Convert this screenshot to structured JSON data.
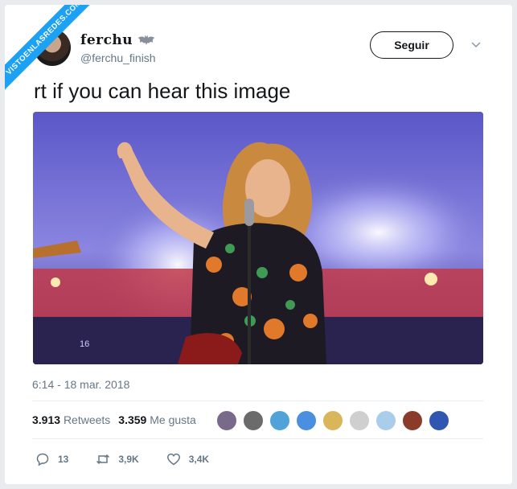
{
  "watermark": "VISTOENLASREDES.COM",
  "author": {
    "display_name": "ferchu",
    "handle": "@ferchu_finish"
  },
  "follow_button": "Seguir",
  "tweet_text": "rt if you can hear this image",
  "media": {
    "screen_number": "16"
  },
  "timestamp": "6:14 - 18 mar. 2018",
  "stats": {
    "retweets_count": "3.913",
    "retweets_label": "Retweets",
    "likes_count": "3.359",
    "likes_label": "Me gusta"
  },
  "actions": {
    "reply_count": "13",
    "retweet_count": "3,9K",
    "like_count": "3,4K"
  },
  "colors": {
    "accent": "#1da1f2",
    "text": "#14171a",
    "muted": "#657786"
  }
}
